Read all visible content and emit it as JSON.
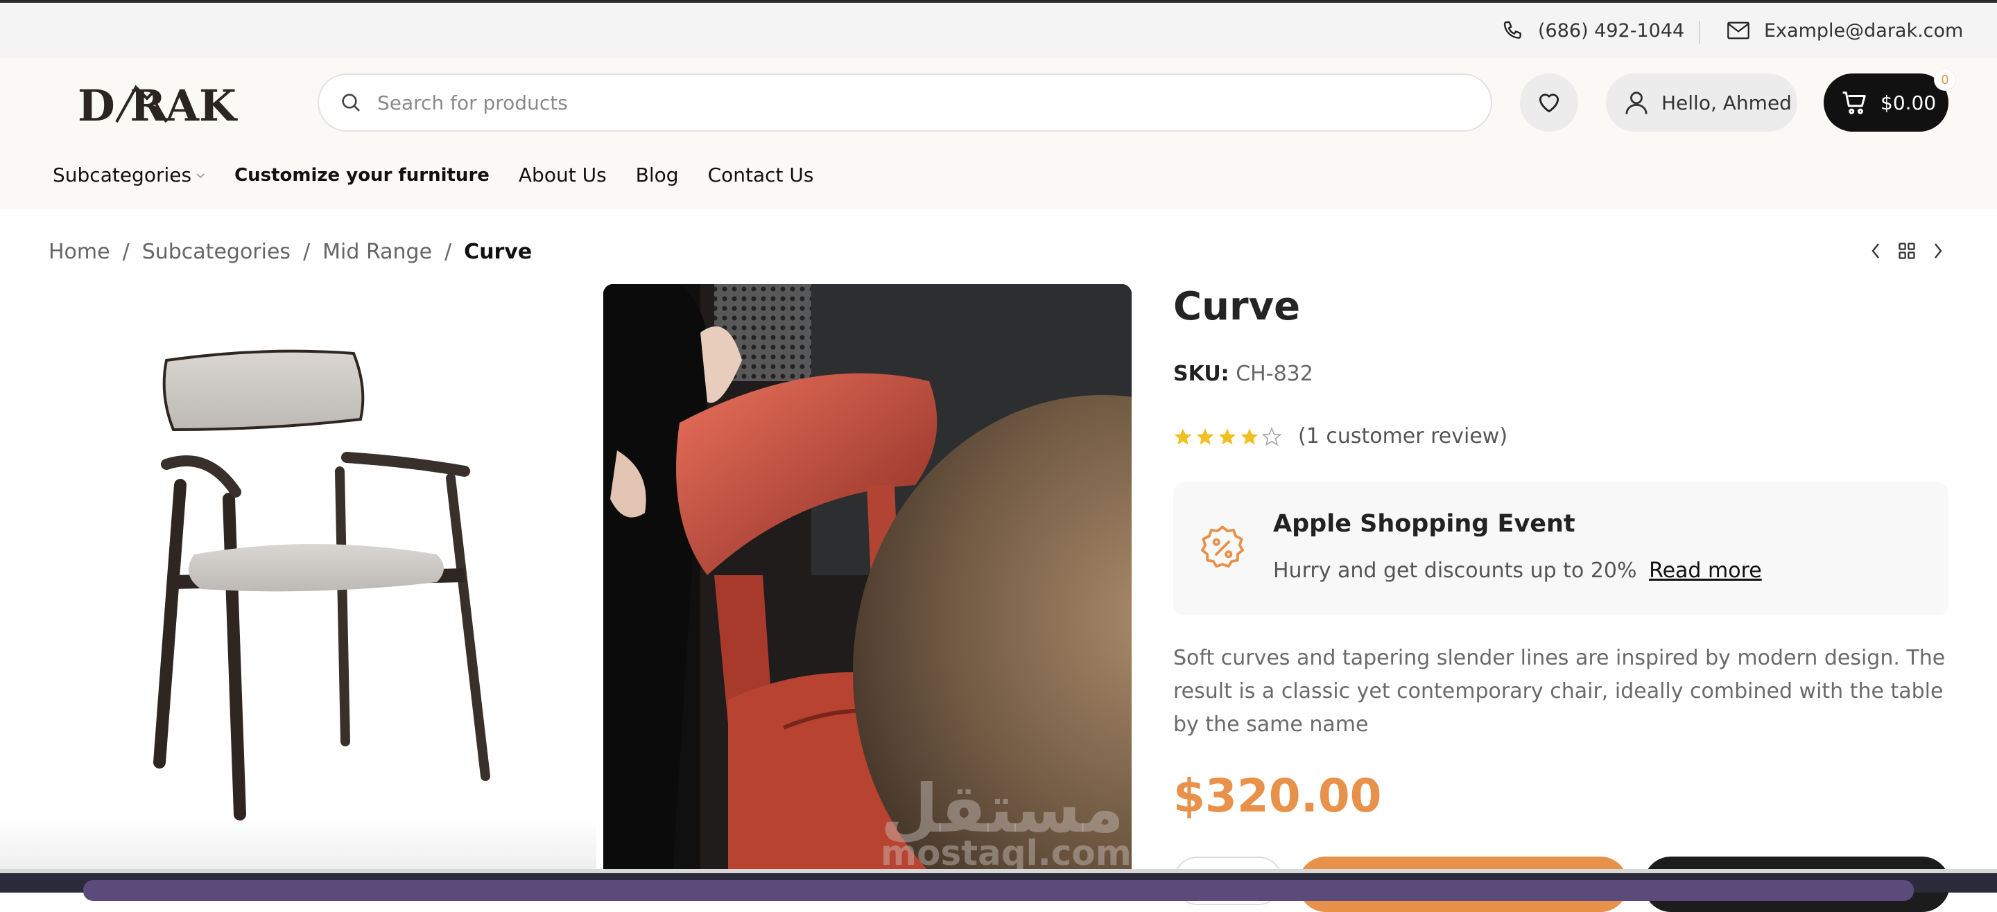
{
  "topbar": {
    "phone": "(686) 492-1044",
    "email": "Example@darak.com",
    "icons": {
      "phone": "phone-icon",
      "email": "envelope-icon"
    }
  },
  "header": {
    "logo_text": "D RAK",
    "search_placeholder": "Search for products",
    "account_label": "Hello, Ahmed",
    "cart_total": "$0.00",
    "cart_count": "0",
    "icons": {
      "search": "search-icon",
      "wishlist": "heart-icon",
      "account": "user-icon",
      "cart": "cart-icon"
    }
  },
  "nav": {
    "items": [
      {
        "label": "Subcategories",
        "has_dropdown": true
      },
      {
        "label": "Customize your furniture"
      },
      {
        "label": "About Us"
      },
      {
        "label": "Blog"
      },
      {
        "label": "Contact Us"
      }
    ]
  },
  "breadcrumb": {
    "items": [
      "Home",
      "Subcategories",
      "Mid Range"
    ],
    "separator": "/",
    "current": "Curve"
  },
  "product": {
    "title": "Curve",
    "sku_label": "SKU:",
    "sku": "CH-832",
    "rating": 4,
    "rating_max": 5,
    "review_text": "(1 customer review)",
    "promo": {
      "title": "Apple Shopping Event",
      "text": "Hurry and get discounts up to 20%",
      "link": "Read more"
    },
    "description": "Soft curves and tapering slender lines are inspired by modern design. The result is a classic yet contemporary chair, ideally combined with the table by the same name",
    "price": "$320.00"
  },
  "watermark": {
    "arabic": "مستقل",
    "latin": "mostaql.com"
  },
  "colors": {
    "accent": "#e8914a",
    "dark": "#111111",
    "header_bg": "#fbf9f5",
    "star": "#f0c020"
  }
}
